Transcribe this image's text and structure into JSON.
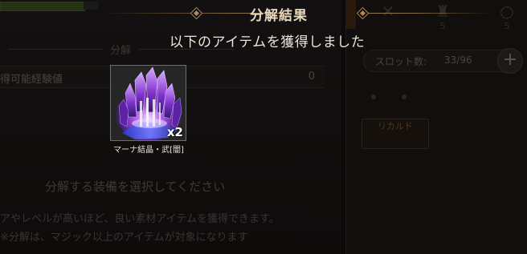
{
  "modal": {
    "title": "分解結果",
    "subtitle": "以下のアイテムを獲得しました",
    "items": [
      {
        "name": "マーナ結晶・武[闇]",
        "quantity": "x2",
        "icon": "purple-mana-crystal-icon"
      }
    ]
  },
  "background": {
    "subhead": "分解",
    "exp_row": {
      "label": "得可能経験値",
      "value": "0"
    },
    "hint_select": "分解する装備を選択してください",
    "hint_rarity": "アやレベルが高いほど、良い素材アイテムを獲得できます。",
    "hint_note": "※分解は、マジック以上のアイテムが対象になります",
    "tabs": [
      {
        "count": "",
        "icon": "sword-icon"
      },
      {
        "count": "5",
        "icon": "armor-icon"
      },
      {
        "count": "5",
        "icon": "ring-icon"
      }
    ],
    "slot": {
      "label": "スロット数:",
      "count": "33/96"
    },
    "mini_item": {
      "label": "リカルド",
      "sub": ""
    }
  },
  "colors": {
    "title_gold": "#e8d9bd",
    "ornament_gold": "#b08a5a",
    "crystal_purple": "#8e3ad6",
    "crystal_blue": "#3b4fd8"
  }
}
